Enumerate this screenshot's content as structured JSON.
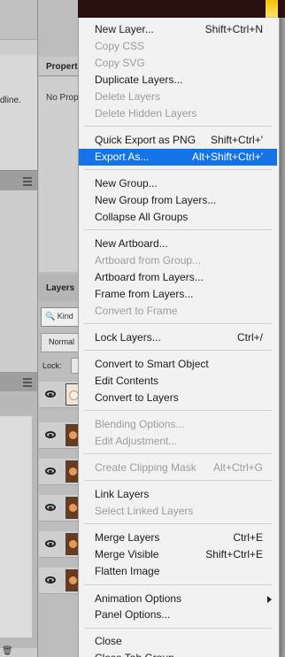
{
  "background": {
    "left_partial_text": "dline.",
    "properties_tab": "Propert",
    "properties_body": "No Prop",
    "layers_tab": "Layers",
    "kind_filter": "Kind",
    "blend_mode": "Normal",
    "lock_label": "Lock:"
  },
  "menu": {
    "items": [
      {
        "label": "New Layer...",
        "shortcut": "Shift+Ctrl+N",
        "disabled": false
      },
      {
        "label": "Copy CSS",
        "shortcut": "",
        "disabled": true
      },
      {
        "label": "Copy SVG",
        "shortcut": "",
        "disabled": true
      },
      {
        "label": "Duplicate Layers...",
        "shortcut": "",
        "disabled": false
      },
      {
        "label": "Delete Layers",
        "shortcut": "",
        "disabled": true
      },
      {
        "label": "Delete Hidden Layers",
        "shortcut": "",
        "disabled": true
      },
      {
        "label": "Quick Export as PNG",
        "shortcut": "Shift+Ctrl+'",
        "disabled": false
      },
      {
        "label": "Export As...",
        "shortcut": "Alt+Shift+Ctrl+'",
        "disabled": false,
        "selected": true
      },
      {
        "label": "New Group...",
        "shortcut": "",
        "disabled": false
      },
      {
        "label": "New Group from Layers...",
        "shortcut": "",
        "disabled": false
      },
      {
        "label": "Collapse All Groups",
        "shortcut": "",
        "disabled": false
      },
      {
        "label": "New Artboard...",
        "shortcut": "",
        "disabled": false
      },
      {
        "label": "Artboard from Group...",
        "shortcut": "",
        "disabled": true
      },
      {
        "label": "Artboard from Layers...",
        "shortcut": "",
        "disabled": false
      },
      {
        "label": "Frame from Layers...",
        "shortcut": "",
        "disabled": false
      },
      {
        "label": "Convert to Frame",
        "shortcut": "",
        "disabled": true
      },
      {
        "label": "Lock Layers...",
        "shortcut": "Ctrl+/",
        "disabled": false
      },
      {
        "label": "Convert to Smart Object",
        "shortcut": "",
        "disabled": false
      },
      {
        "label": "Edit Contents",
        "shortcut": "",
        "disabled": false
      },
      {
        "label": "Convert to Layers",
        "shortcut": "",
        "disabled": false
      },
      {
        "label": "Blending Options...",
        "shortcut": "",
        "disabled": true
      },
      {
        "label": "Edit Adjustment...",
        "shortcut": "",
        "disabled": true
      },
      {
        "label": "Create Clipping Mask",
        "shortcut": "Alt+Ctrl+G",
        "disabled": true
      },
      {
        "label": "Link Layers",
        "shortcut": "",
        "disabled": false
      },
      {
        "label": "Select Linked Layers",
        "shortcut": "",
        "disabled": true
      },
      {
        "label": "Merge Layers",
        "shortcut": "Ctrl+E",
        "disabled": false
      },
      {
        "label": "Merge Visible",
        "shortcut": "Shift+Ctrl+E",
        "disabled": false
      },
      {
        "label": "Flatten Image",
        "shortcut": "",
        "disabled": false
      },
      {
        "label": "Animation Options",
        "shortcut": "",
        "disabled": false,
        "submenu": true
      },
      {
        "label": "Panel Options...",
        "shortcut": "",
        "disabled": false
      },
      {
        "label": "Close",
        "shortcut": "",
        "disabled": false
      },
      {
        "label": "Close Tab Group",
        "shortcut": "",
        "disabled": false
      }
    ]
  }
}
